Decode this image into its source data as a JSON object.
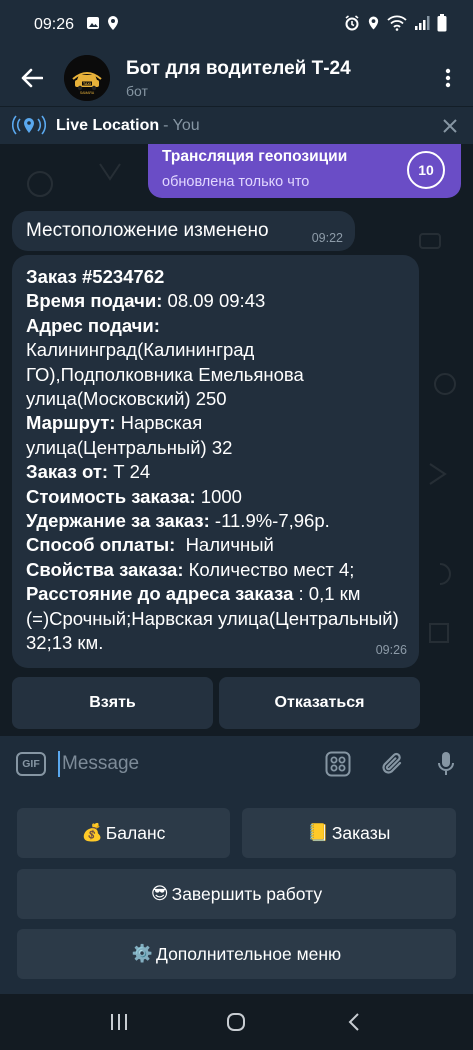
{
  "statusbar": {
    "time": "09:26",
    "icons": [
      "image-icon",
      "location-icon",
      "alarm-icon",
      "location-icon",
      "wifi-icon",
      "signal-icon",
      "battery-icon"
    ]
  },
  "header": {
    "title": "Бот для водителей Т-24",
    "subtitle": "бот",
    "avatar_text": "TAXI",
    "avatar_subtext": "SAMARA"
  },
  "live_location": {
    "label": "Live Location",
    "who": "- You"
  },
  "messages": {
    "outgoing": {
      "title": "Трансляция геопозиции",
      "subtitle": "обновлена только что",
      "timer": "10"
    },
    "location_changed": {
      "text": "Местоположение изменено",
      "time": "09:22"
    },
    "order": {
      "order_label": "Заказ #5234762",
      "time_label": "Время подачи:",
      "time_value": " 08.09 09:43",
      "address_label": "Адрес подачи:",
      "address_value": "Калининград(Калининград ГО),Подполковника Емельянова улица(Московский) 250",
      "route_label": "Маршрут:",
      "route_value": " Нарвская улица(Центральный) 32",
      "from_label": "Заказ от:",
      "from_value": " Т 24",
      "cost_label": "Стоимость заказа:",
      "cost_value": " 1000",
      "hold_label": "Удержание за заказ:",
      "hold_value": " -11.9%-7,96р.",
      "payment_label": "Способ оплаты:",
      "payment_value": "  Наличный",
      "props_label": "Свойства заказа:",
      "props_value": " Количество мест 4;",
      "distance_label": "Расстояние до адреса заказа",
      "distance_value": " : 0,1 км (=)Срочный;Нарвская улица(Центральный) 32;13 км.",
      "time": "09:26"
    }
  },
  "inline_buttons": {
    "take": "Взять",
    "decline": "Отказаться"
  },
  "input": {
    "gif": "GIF",
    "placeholder": "Message"
  },
  "keyboard": {
    "balance": {
      "emoji": "💰",
      "label": "Баланс"
    },
    "orders": {
      "emoji": "📒",
      "label": "Заказы"
    },
    "finish": {
      "emoji": "😎",
      "label": "Завершить работу"
    },
    "extra": {
      "emoji": "⚙️",
      "label": "Дополнительное меню"
    }
  },
  "colors": {
    "header_bg": "#1e2c3a",
    "chat_bg": "#131c24",
    "incoming_bubble": "#222f3d",
    "outgoing_bubble": "#6a4dc6",
    "accent_blue": "#5aa8ee"
  }
}
